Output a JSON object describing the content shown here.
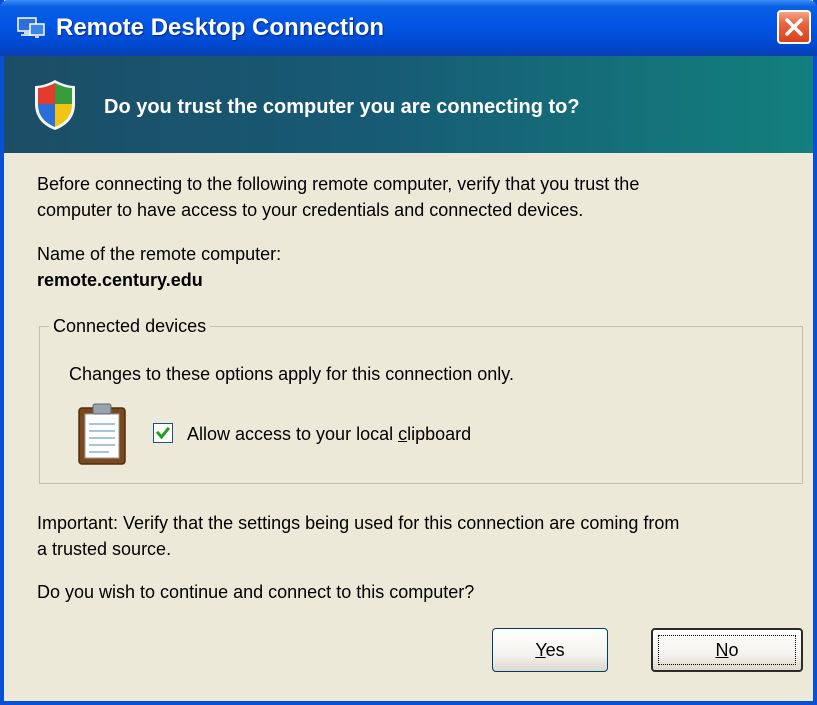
{
  "window": {
    "title": "Remote Desktop Connection",
    "close_icon": "close-icon"
  },
  "banner": {
    "icon": "shield-icon",
    "heading": "Do you trust the computer you are connecting to?"
  },
  "body": {
    "intro_line1": "Before connecting to the following remote computer, verify that you trust the",
    "intro_line2": "computer to have access to your credentials and connected devices.",
    "remote_label": "Name of the remote computer:",
    "remote_name": "remote.century.edu"
  },
  "devices": {
    "legend": "Connected devices",
    "note": "Changes to these options apply for this connection only.",
    "clipboard_icon": "clipboard-icon",
    "clipboard_label_before": "Allow access to your local ",
    "clipboard_label_accel": "c",
    "clipboard_label_after": "lipboard",
    "clipboard_checked": true
  },
  "footer": {
    "important_line1": "Important: Verify that the settings being used for this connection are coming from",
    "important_line2": "a trusted source.",
    "question": "Do you wish to continue and connect to this computer?"
  },
  "buttons": {
    "yes_accel": "Y",
    "yes_rest": "es",
    "no_accel": "N",
    "no_rest": "o"
  },
  "colors": {
    "titlebar": "#0055E5",
    "banner_start": "#1C4D66",
    "banner_end": "#12807E",
    "dialog_bg": "#ECE9D8",
    "close_button": "#D9421C"
  }
}
